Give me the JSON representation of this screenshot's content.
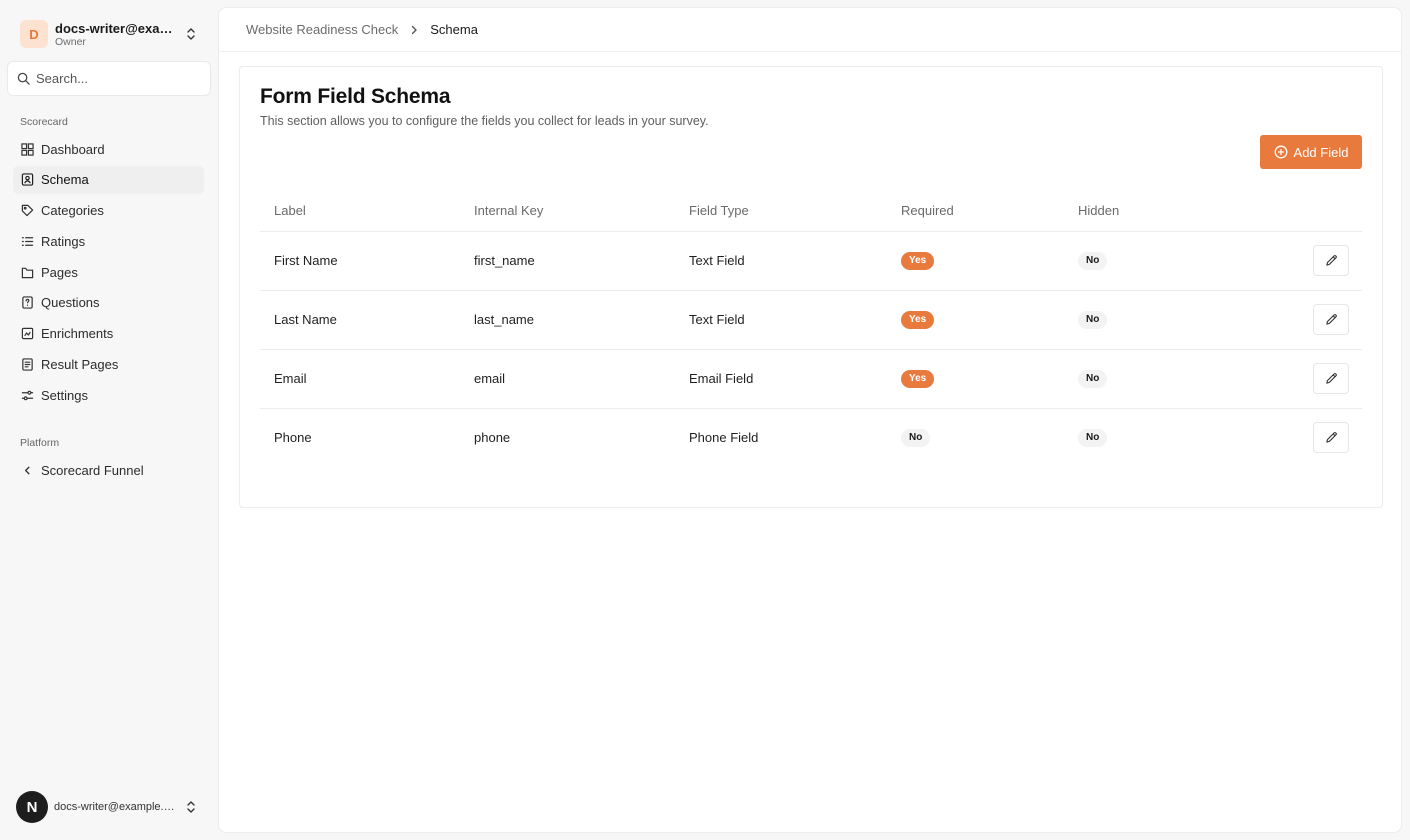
{
  "account": {
    "initial": "D",
    "name": "docs-writer@example.com",
    "role": "Owner"
  },
  "search": {
    "placeholder": "Search..."
  },
  "sidebar": {
    "group_scorecard": "Scorecard",
    "items": [
      {
        "label": "Dashboard",
        "icon": "dashboard-icon"
      },
      {
        "label": "Schema",
        "icon": "schema-icon"
      },
      {
        "label": "Categories",
        "icon": "tag-icon"
      },
      {
        "label": "Ratings",
        "icon": "list-icon"
      },
      {
        "label": "Pages",
        "icon": "pages-icon"
      },
      {
        "label": "Questions",
        "icon": "question-icon"
      },
      {
        "label": "Enrichments",
        "icon": "enrichment-icon"
      },
      {
        "label": "Result Pages",
        "icon": "document-icon"
      },
      {
        "label": "Settings",
        "icon": "settings-icon"
      }
    ],
    "active_item": "Schema",
    "group_platform": "Platform",
    "platform_items": [
      {
        "label": "Scorecard Funnel",
        "icon": "chevron-left-icon"
      }
    ]
  },
  "user": {
    "initial": "N",
    "email": "docs-writer@example.com"
  },
  "breadcrumb": {
    "parent": "Website Readiness Check",
    "current": "Schema"
  },
  "card": {
    "title": "Form Field Schema",
    "description": "This section allows you to configure the fields you collect for leads in your survey.",
    "add_button": "Add Field"
  },
  "table": {
    "columns": [
      "Label",
      "Internal Key",
      "Field Type",
      "Required",
      "Hidden"
    ],
    "rows": [
      {
        "label": "First Name",
        "key": "first_name",
        "type": "Text Field",
        "required": "Yes",
        "hidden": "No"
      },
      {
        "label": "Last Name",
        "key": "last_name",
        "type": "Text Field",
        "required": "Yes",
        "hidden": "No"
      },
      {
        "label": "Email",
        "key": "email",
        "type": "Email Field",
        "required": "Yes",
        "hidden": "No"
      },
      {
        "label": "Phone",
        "key": "phone",
        "type": "Phone Field",
        "required": "No",
        "hidden": "No"
      }
    ]
  },
  "colors": {
    "accent": "#e97a3e",
    "avatar_bg": "#fde2d1"
  }
}
